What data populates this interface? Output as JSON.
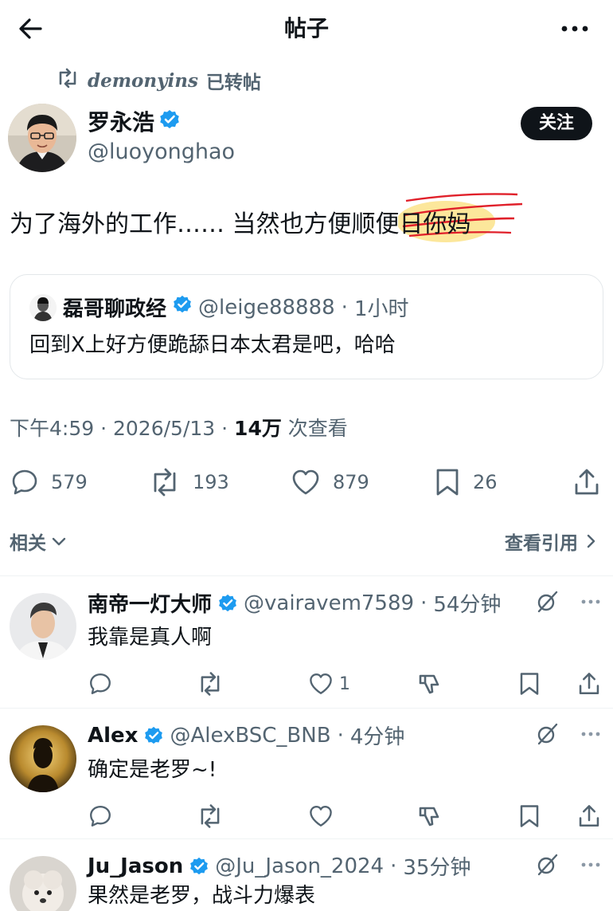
{
  "header": {
    "title": "帖子"
  },
  "repost": {
    "user": "demonyins",
    "label": "已转帖"
  },
  "author": {
    "name": "罗永浩",
    "handle": "@luoyonghao",
    "follow_label": "关注"
  },
  "post": {
    "text": "为了海外的工作…… 当然也方便顺便日你妈"
  },
  "quote": {
    "name": "磊哥聊政经",
    "handle": "@leige88888",
    "sep": "·",
    "time": "1小时",
    "text": "回到X上好方便跪舔日本太君是吧，哈哈"
  },
  "meta": {
    "time": "下午4:59",
    "sep": "·",
    "date": "2026/5/13",
    "views": "14万",
    "views_label": "次查看"
  },
  "stats": {
    "replies": "579",
    "reposts": "193",
    "likes": "879",
    "bookmarks": "26"
  },
  "tabs": {
    "relevant": "相关",
    "quotes": "查看引用"
  },
  "replies": [
    {
      "name": "南帝一灯大师",
      "handle": "@vairavem7589",
      "sep": "·",
      "time": "54分钟",
      "text": "我靠是真人啊",
      "likes": "1"
    },
    {
      "name": "Alex",
      "handle": "@AlexBSC_BNB",
      "sep": "·",
      "time": "4分钟",
      "text": "确定是老罗~!",
      "likes": ""
    },
    {
      "name": "Ju_Jason",
      "handle": "@Ju_Jason_2024",
      "sep": "·",
      "time": "35分钟",
      "text": "果然是老罗，战斗力爆表",
      "likes": ""
    }
  ],
  "colors": {
    "verified": "#1d9bf0",
    "text": "#0f1419",
    "secondary": "#536471",
    "border": "#e3e7ea",
    "scribble": "#e0202a",
    "highlight": "#fbe38a"
  }
}
